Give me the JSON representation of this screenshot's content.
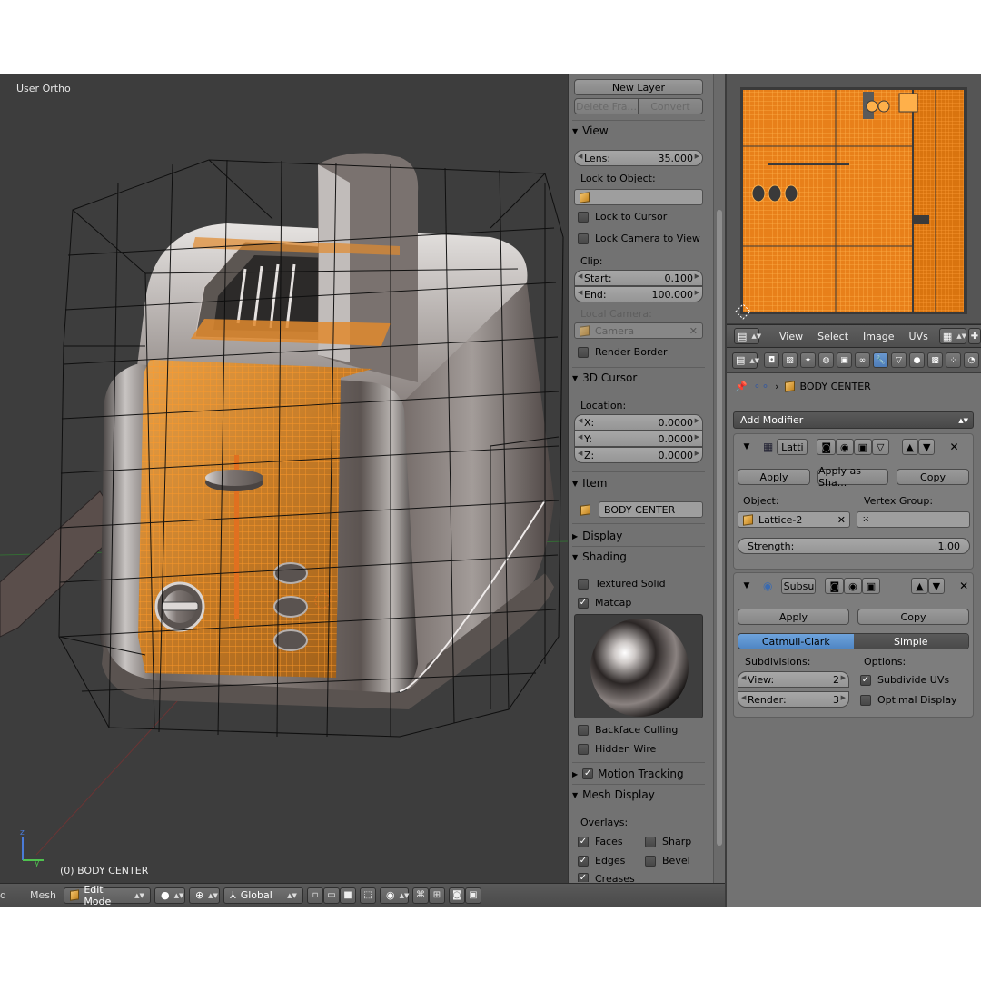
{
  "viewport": {
    "view_name": "User Ortho",
    "object_info": "(0) BODY CENTER"
  },
  "bottom_header": {
    "view_menu": "d",
    "mesh_menu": "Mesh",
    "mode": "Edit Mode",
    "orientation": "Global"
  },
  "npanel": {
    "new_layer": "New Layer",
    "delete_frame": "Delete Fra...",
    "convert": "Convert",
    "view_section": "View",
    "lens_label": "Lens:",
    "lens_value": "35.000",
    "lock_to_object": "Lock to Object:",
    "lock_to_cursor": "Lock to Cursor",
    "lock_camera": "Lock Camera to View",
    "clip": "Clip:",
    "clip_start_label": "Start:",
    "clip_start": "0.100",
    "clip_end_label": "End:",
    "clip_end": "100.000",
    "local_camera": "Local Camera:",
    "camera": "Camera",
    "render_border": "Render Border",
    "cursor_section": "3D Cursor",
    "location": "Location:",
    "x_label": "X:",
    "x": "0.0000",
    "y_label": "Y:",
    "y": "0.0000",
    "z_label": "Z:",
    "z": "0.0000",
    "item_section": "Item",
    "item_name": "BODY CENTER",
    "display_section": "Display",
    "shading_section": "Shading",
    "textured_solid": "Textured Solid",
    "matcap": "Matcap",
    "backface_culling": "Backface Culling",
    "hidden_wire": "Hidden Wire",
    "motion_tracking": "Motion Tracking",
    "mesh_display": "Mesh Display",
    "overlays": "Overlays:",
    "faces": "Faces",
    "sharp": "Sharp",
    "edges": "Edges",
    "bevel": "Bevel",
    "creases": "Creases"
  },
  "uv_header": {
    "view": "View",
    "select": "Select",
    "image": "Image",
    "uvs": "UVs"
  },
  "properties": {
    "object_name": "BODY CENTER",
    "add_modifier": "Add Modifier",
    "lattice": {
      "name": "Latti",
      "apply": "Apply",
      "apply_shape": "Apply as Sha...",
      "copy": "Copy",
      "object_label": "Object:",
      "vertex_group_label": "Vertex Group:",
      "object_value": "Lattice-2",
      "strength_label": "Strength:",
      "strength_value": "1.00"
    },
    "subsurf": {
      "name": "Subsu",
      "apply": "Apply",
      "copy": "Copy",
      "catmull": "Catmull-Clark",
      "simple": "Simple",
      "subdivisions": "Subdivisions:",
      "options": "Options:",
      "view_label": "View:",
      "view_value": "2",
      "render_label": "Render:",
      "render_value": "3",
      "subdivide_uvs": "Subdivide UVs",
      "optimal_display": "Optimal Display"
    }
  }
}
